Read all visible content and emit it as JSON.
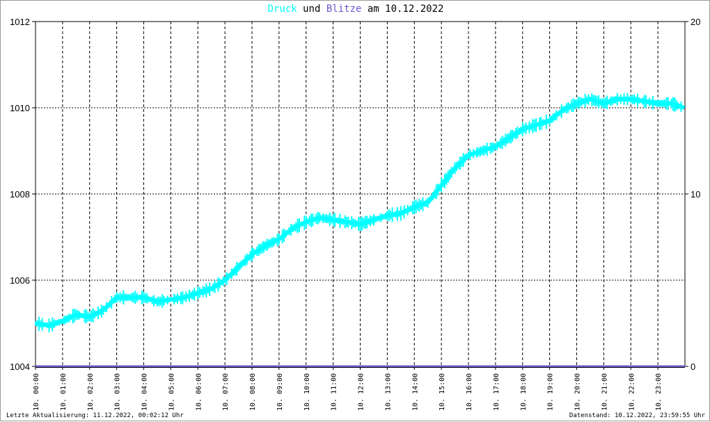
{
  "chart_data": {
    "type": "line",
    "title": {
      "part1": "Druck",
      "part2": "und",
      "part3": "Blitze",
      "part4": "am 10.12.2022"
    },
    "colors": {
      "druck": "#00ffff",
      "blitze": "#6a5acd",
      "grid": "#000000"
    },
    "y_left": {
      "range": [
        1004,
        1012
      ],
      "ticks": [
        "1004",
        "1006",
        "1008",
        "1010",
        "1012"
      ]
    },
    "y_right": {
      "range": [
        0,
        20
      ],
      "ticks": [
        "0",
        "10",
        "20"
      ]
    },
    "x_ticks": [
      "10. 00:00",
      "10. 01:00",
      "10. 02:00",
      "10. 03:00",
      "10. 04:00",
      "10. 05:00",
      "10. 06:00",
      "10. 07:00",
      "10. 08:00",
      "10. 09:00",
      "10. 10:00",
      "10. 11:00",
      "10. 12:00",
      "10. 13:00",
      "10. 14:00",
      "10. 15:00",
      "10. 16:00",
      "10. 17:00",
      "10. 18:00",
      "10. 19:00",
      "10. 20:00",
      "10. 21:00",
      "10. 22:00",
      "10. 23:00"
    ],
    "x_range_hours": [
      0,
      24
    ],
    "series": [
      {
        "name": "Druck",
        "x_hours": [
          0,
          0.5,
          1,
          1.5,
          2,
          2.5,
          3,
          3.5,
          4,
          4.5,
          5,
          5.5,
          6,
          6.5,
          7,
          7.5,
          8,
          8.5,
          9,
          9.5,
          10,
          10.5,
          11,
          11.5,
          12,
          12.5,
          13,
          13.5,
          14,
          14.5,
          15,
          15.5,
          16,
          16.5,
          17,
          17.5,
          18,
          18.5,
          19,
          19.5,
          20,
          20.5,
          21,
          21.5,
          22,
          22.5,
          23,
          23.5,
          23.98
        ],
        "values": [
          1005.0,
          1004.95,
          1005.05,
          1005.2,
          1005.15,
          1005.3,
          1005.6,
          1005.6,
          1005.6,
          1005.5,
          1005.55,
          1005.6,
          1005.7,
          1005.8,
          1006.0,
          1006.3,
          1006.6,
          1006.8,
          1006.95,
          1007.2,
          1007.35,
          1007.45,
          1007.4,
          1007.35,
          1007.3,
          1007.4,
          1007.5,
          1007.55,
          1007.7,
          1007.8,
          1008.2,
          1008.6,
          1008.9,
          1009.0,
          1009.1,
          1009.3,
          1009.5,
          1009.6,
          1009.7,
          1009.95,
          1010.1,
          1010.2,
          1010.1,
          1010.2,
          1010.2,
          1010.15,
          1010.1,
          1010.1,
          1010.0
        ]
      },
      {
        "name": "Blitze",
        "x_hours": [
          0,
          24
        ],
        "values": [
          0,
          0
        ]
      }
    ]
  },
  "footer": {
    "left": "Letzte Aktualisierung: 11.12.2022, 00:02:12 Uhr",
    "right": "Datenstand: 10.12.2022, 23:59:55 Uhr"
  }
}
